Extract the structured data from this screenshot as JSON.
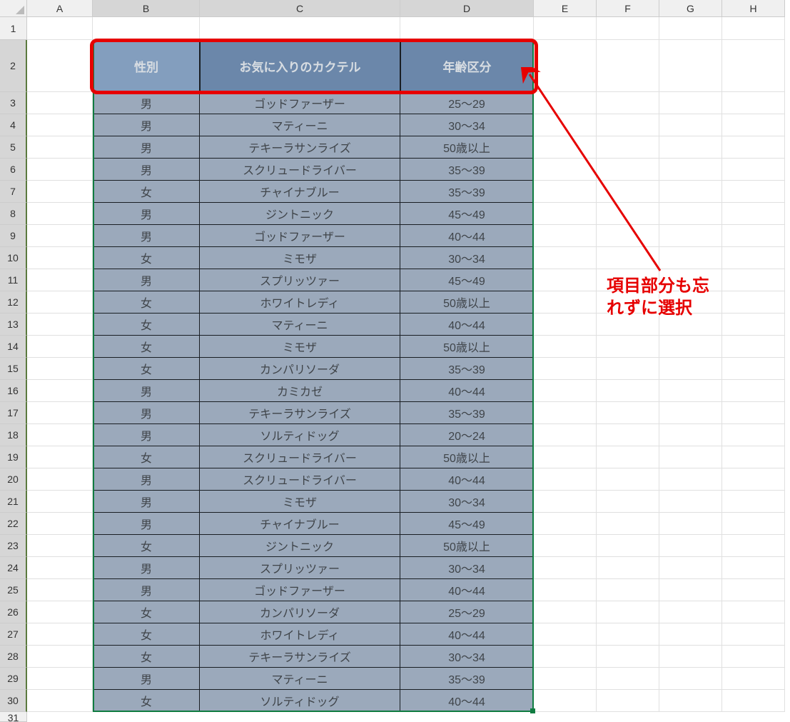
{
  "columns": [
    "A",
    "B",
    "C",
    "D",
    "E",
    "F",
    "G",
    "H"
  ],
  "selected_cols": [
    "B",
    "C",
    "D"
  ],
  "selected_rows": [
    2,
    3,
    4,
    5,
    6,
    7,
    8,
    9,
    10,
    11,
    12,
    13,
    14,
    15,
    16,
    17,
    18,
    19,
    20,
    21,
    22,
    23,
    24,
    25,
    26,
    27,
    28,
    29,
    30
  ],
  "table": {
    "headers": [
      "性別",
      "お気に入りのカクテル",
      "年齢区分"
    ],
    "rows": [
      [
        "男",
        "ゴッドファーザー",
        "25～29"
      ],
      [
        "男",
        "マティーニ",
        "30～34"
      ],
      [
        "男",
        "テキーラサンライズ",
        "50歳以上"
      ],
      [
        "男",
        "スクリュードライバー",
        "35～39"
      ],
      [
        "女",
        "チャイナブルー",
        "35～39"
      ],
      [
        "男",
        "ジントニック",
        "45～49"
      ],
      [
        "男",
        "ゴッドファーザー",
        "40～44"
      ],
      [
        "女",
        "ミモザ",
        "30～34"
      ],
      [
        "男",
        "スプリッツァー",
        "45～49"
      ],
      [
        "女",
        "ホワイトレディ",
        "50歳以上"
      ],
      [
        "女",
        "マティーニ",
        "40～44"
      ],
      [
        "女",
        "ミモザ",
        "50歳以上"
      ],
      [
        "女",
        "カンパリソーダ",
        "35～39"
      ],
      [
        "男",
        "カミカゼ",
        "40～44"
      ],
      [
        "男",
        "テキーラサンライズ",
        "35～39"
      ],
      [
        "男",
        "ソルティドッグ",
        "20～24"
      ],
      [
        "女",
        "スクリュードライバー",
        "50歳以上"
      ],
      [
        "男",
        "スクリュードライバー",
        "40～44"
      ],
      [
        "男",
        "ミモザ",
        "30～34"
      ],
      [
        "男",
        "チャイナブルー",
        "45～49"
      ],
      [
        "女",
        "ジントニック",
        "50歳以上"
      ],
      [
        "男",
        "スプリッツァー",
        "30～34"
      ],
      [
        "男",
        "ゴッドファーザー",
        "40～44"
      ],
      [
        "女",
        "カンパリソーダ",
        "25～29"
      ],
      [
        "女",
        "ホワイトレディ",
        "40～44"
      ],
      [
        "女",
        "テキーラサンライズ",
        "30～34"
      ],
      [
        "男",
        "マティーニ",
        "35～39"
      ],
      [
        "女",
        "ソルティドッグ",
        "40～44"
      ]
    ]
  },
  "annotation": {
    "text": "項目部分も忘れずに選択"
  },
  "colors": {
    "highlight": "#e60000",
    "selection_border": "#107c41",
    "header_bg": "#6e8db5",
    "header_active_bg": "#8eabcf",
    "data_bg": "#aebacb"
  }
}
